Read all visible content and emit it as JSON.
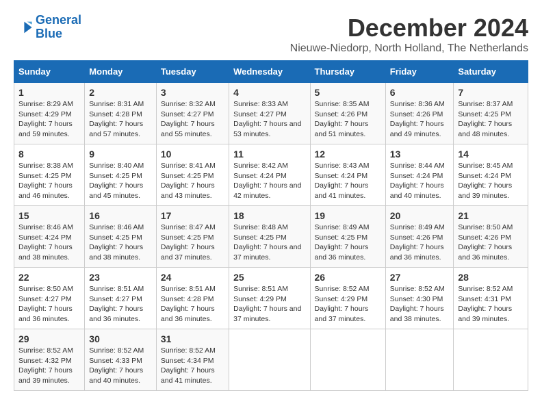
{
  "logo": {
    "line1": "General",
    "line2": "Blue"
  },
  "title": "December 2024",
  "subtitle": "Nieuwe-Niedorp, North Holland, The Netherlands",
  "header": {
    "colors": {
      "accent": "#1a6bb5"
    }
  },
  "weekdays": [
    "Sunday",
    "Monday",
    "Tuesday",
    "Wednesday",
    "Thursday",
    "Friday",
    "Saturday"
  ],
  "weeks": [
    [
      {
        "day": "1",
        "sunrise": "Sunrise: 8:29 AM",
        "sunset": "Sunset: 4:29 PM",
        "daylight": "Daylight: 7 hours and 59 minutes."
      },
      {
        "day": "2",
        "sunrise": "Sunrise: 8:31 AM",
        "sunset": "Sunset: 4:28 PM",
        "daylight": "Daylight: 7 hours and 57 minutes."
      },
      {
        "day": "3",
        "sunrise": "Sunrise: 8:32 AM",
        "sunset": "Sunset: 4:27 PM",
        "daylight": "Daylight: 7 hours and 55 minutes."
      },
      {
        "day": "4",
        "sunrise": "Sunrise: 8:33 AM",
        "sunset": "Sunset: 4:27 PM",
        "daylight": "Daylight: 7 hours and 53 minutes."
      },
      {
        "day": "5",
        "sunrise": "Sunrise: 8:35 AM",
        "sunset": "Sunset: 4:26 PM",
        "daylight": "Daylight: 7 hours and 51 minutes."
      },
      {
        "day": "6",
        "sunrise": "Sunrise: 8:36 AM",
        "sunset": "Sunset: 4:26 PM",
        "daylight": "Daylight: 7 hours and 49 minutes."
      },
      {
        "day": "7",
        "sunrise": "Sunrise: 8:37 AM",
        "sunset": "Sunset: 4:25 PM",
        "daylight": "Daylight: 7 hours and 48 minutes."
      }
    ],
    [
      {
        "day": "8",
        "sunrise": "Sunrise: 8:38 AM",
        "sunset": "Sunset: 4:25 PM",
        "daylight": "Daylight: 7 hours and 46 minutes."
      },
      {
        "day": "9",
        "sunrise": "Sunrise: 8:40 AM",
        "sunset": "Sunset: 4:25 PM",
        "daylight": "Daylight: 7 hours and 45 minutes."
      },
      {
        "day": "10",
        "sunrise": "Sunrise: 8:41 AM",
        "sunset": "Sunset: 4:25 PM",
        "daylight": "Daylight: 7 hours and 43 minutes."
      },
      {
        "day": "11",
        "sunrise": "Sunrise: 8:42 AM",
        "sunset": "Sunset: 4:24 PM",
        "daylight": "Daylight: 7 hours and 42 minutes."
      },
      {
        "day": "12",
        "sunrise": "Sunrise: 8:43 AM",
        "sunset": "Sunset: 4:24 PM",
        "daylight": "Daylight: 7 hours and 41 minutes."
      },
      {
        "day": "13",
        "sunrise": "Sunrise: 8:44 AM",
        "sunset": "Sunset: 4:24 PM",
        "daylight": "Daylight: 7 hours and 40 minutes."
      },
      {
        "day": "14",
        "sunrise": "Sunrise: 8:45 AM",
        "sunset": "Sunset: 4:24 PM",
        "daylight": "Daylight: 7 hours and 39 minutes."
      }
    ],
    [
      {
        "day": "15",
        "sunrise": "Sunrise: 8:46 AM",
        "sunset": "Sunset: 4:24 PM",
        "daylight": "Daylight: 7 hours and 38 minutes."
      },
      {
        "day": "16",
        "sunrise": "Sunrise: 8:46 AM",
        "sunset": "Sunset: 4:25 PM",
        "daylight": "Daylight: 7 hours and 38 minutes."
      },
      {
        "day": "17",
        "sunrise": "Sunrise: 8:47 AM",
        "sunset": "Sunset: 4:25 PM",
        "daylight": "Daylight: 7 hours and 37 minutes."
      },
      {
        "day": "18",
        "sunrise": "Sunrise: 8:48 AM",
        "sunset": "Sunset: 4:25 PM",
        "daylight": "Daylight: 7 hours and 37 minutes."
      },
      {
        "day": "19",
        "sunrise": "Sunrise: 8:49 AM",
        "sunset": "Sunset: 4:25 PM",
        "daylight": "Daylight: 7 hours and 36 minutes."
      },
      {
        "day": "20",
        "sunrise": "Sunrise: 8:49 AM",
        "sunset": "Sunset: 4:26 PM",
        "daylight": "Daylight: 7 hours and 36 minutes."
      },
      {
        "day": "21",
        "sunrise": "Sunrise: 8:50 AM",
        "sunset": "Sunset: 4:26 PM",
        "daylight": "Daylight: 7 hours and 36 minutes."
      }
    ],
    [
      {
        "day": "22",
        "sunrise": "Sunrise: 8:50 AM",
        "sunset": "Sunset: 4:27 PM",
        "daylight": "Daylight: 7 hours and 36 minutes."
      },
      {
        "day": "23",
        "sunrise": "Sunrise: 8:51 AM",
        "sunset": "Sunset: 4:27 PM",
        "daylight": "Daylight: 7 hours and 36 minutes."
      },
      {
        "day": "24",
        "sunrise": "Sunrise: 8:51 AM",
        "sunset": "Sunset: 4:28 PM",
        "daylight": "Daylight: 7 hours and 36 minutes."
      },
      {
        "day": "25",
        "sunrise": "Sunrise: 8:51 AM",
        "sunset": "Sunset: 4:29 PM",
        "daylight": "Daylight: 7 hours and 37 minutes."
      },
      {
        "day": "26",
        "sunrise": "Sunrise: 8:52 AM",
        "sunset": "Sunset: 4:29 PM",
        "daylight": "Daylight: 7 hours and 37 minutes."
      },
      {
        "day": "27",
        "sunrise": "Sunrise: 8:52 AM",
        "sunset": "Sunset: 4:30 PM",
        "daylight": "Daylight: 7 hours and 38 minutes."
      },
      {
        "day": "28",
        "sunrise": "Sunrise: 8:52 AM",
        "sunset": "Sunset: 4:31 PM",
        "daylight": "Daylight: 7 hours and 39 minutes."
      }
    ],
    [
      {
        "day": "29",
        "sunrise": "Sunrise: 8:52 AM",
        "sunset": "Sunset: 4:32 PM",
        "daylight": "Daylight: 7 hours and 39 minutes."
      },
      {
        "day": "30",
        "sunrise": "Sunrise: 8:52 AM",
        "sunset": "Sunset: 4:33 PM",
        "daylight": "Daylight: 7 hours and 40 minutes."
      },
      {
        "day": "31",
        "sunrise": "Sunrise: 8:52 AM",
        "sunset": "Sunset: 4:34 PM",
        "daylight": "Daylight: 7 hours and 41 minutes."
      },
      null,
      null,
      null,
      null
    ]
  ]
}
